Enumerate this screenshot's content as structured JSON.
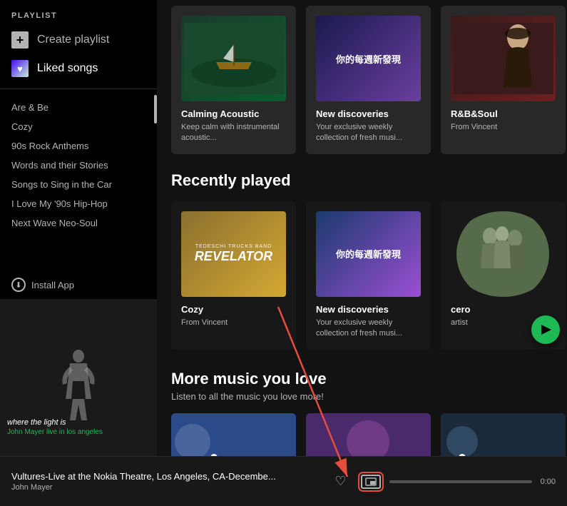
{
  "sidebar": {
    "section_label": "PLAYLIST",
    "create_playlist": "Create playlist",
    "liked_songs": "Liked songs",
    "playlists": [
      {
        "name": "Are & Be"
      },
      {
        "name": "Cozy"
      },
      {
        "name": "90s Rock Anthems"
      },
      {
        "name": "Words and their Stories"
      },
      {
        "name": "Songs to Sing in the Car"
      },
      {
        "name": "I Love My '90s Hip-Hop"
      },
      {
        "name": "Next Wave Neo-Soul"
      }
    ],
    "install_app": "Install App"
  },
  "now_playing_sidebar": {
    "title": "where the light is",
    "artist": "John Mayer live in los angeles"
  },
  "top_cards": [
    {
      "title": "Calming Acoustic",
      "subtitle": "Keep calm with instrumental acoustic...",
      "img_type": "calming"
    },
    {
      "title": "New discoveries",
      "subtitle": "Your exclusive weekly collection of fresh musi...",
      "img_type": "newdisc",
      "chinese": "你的每週新發現"
    },
    {
      "title": "R&B&Soul",
      "subtitle": "From Vincent",
      "img_type": "rnb"
    }
  ],
  "recently_played": {
    "section_title": "Recently played",
    "cards": [
      {
        "title": "Cozy",
        "subtitle": "From Vincent",
        "img_type": "revelator"
      },
      {
        "title": "New discoveries",
        "subtitle": "Your exclusive weekly collection of fresh musi...",
        "img_type": "newdisc",
        "chinese": "你的每週新發現"
      },
      {
        "title": "cero",
        "subtitle": "artist",
        "img_type": "cero",
        "has_play": true
      }
    ]
  },
  "more_music": {
    "section_title": "More music you love",
    "subtitle": "Listen to all the music you love more!"
  },
  "player": {
    "track_title": "Vultures-Live at the Nokia Theatre, Los Angeles, CA-Decembe...",
    "artist": "John Mayer",
    "time": "0:00"
  },
  "annotation": {
    "cozy_text": "Cozy From Vincent"
  }
}
